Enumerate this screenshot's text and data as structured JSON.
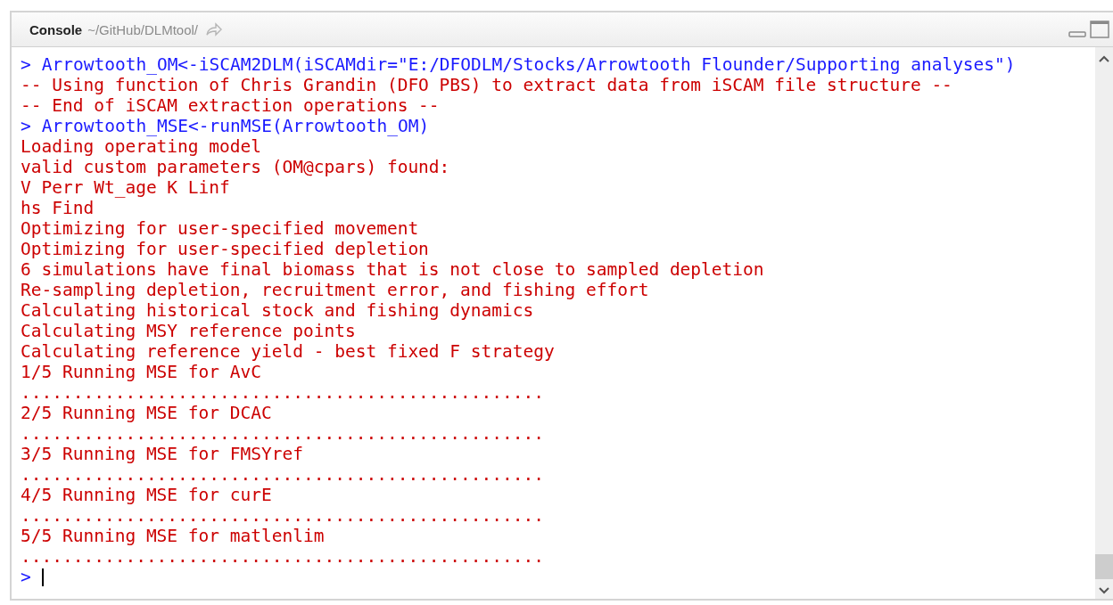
{
  "panel": {
    "title": "Console",
    "path": "~/GitHub/DLMtool/"
  },
  "lines": [
    {
      "kind": "command",
      "prompt": ">",
      "text": "Arrowtooth_OM<-iSCAM2DLM(iSCAMdir=\"E:/DFODLM/Stocks/Arrowtooth Flounder/Supporting analyses\")"
    },
    {
      "kind": "output",
      "text": "-- Using function of Chris Grandin (DFO PBS) to extract data from iSCAM file structure --"
    },
    {
      "kind": "output",
      "text": "-- End of iSCAM extraction operations --"
    },
    {
      "kind": "command",
      "prompt": ">",
      "text": "Arrowtooth_MSE<-runMSE(Arrowtooth_OM)"
    },
    {
      "kind": "output",
      "text": "Loading operating model"
    },
    {
      "kind": "output",
      "text": "valid custom parameters (OM@cpars) found:"
    },
    {
      "kind": "output",
      "text": "V Perr Wt_age K Linf"
    },
    {
      "kind": "output",
      "text": "hs Find"
    },
    {
      "kind": "output",
      "text": "Optimizing for user-specified movement"
    },
    {
      "kind": "output",
      "text": "Optimizing for user-specified depletion"
    },
    {
      "kind": "output",
      "text": "6 simulations have final biomass that is not close to sampled depletion"
    },
    {
      "kind": "output",
      "text": "Re-sampling depletion, recruitment error, and fishing effort"
    },
    {
      "kind": "output",
      "text": "Calculating historical stock and fishing dynamics"
    },
    {
      "kind": "output",
      "text": "Calculating MSY reference points"
    },
    {
      "kind": "output",
      "text": "Calculating reference yield - best fixed F strategy"
    },
    {
      "kind": "output",
      "text": "1/5 Running MSE for AvC"
    },
    {
      "kind": "progress",
      "text": ".................................................."
    },
    {
      "kind": "output",
      "text": "2/5 Running MSE for DCAC"
    },
    {
      "kind": "progress",
      "text": ".................................................."
    },
    {
      "kind": "output",
      "text": "3/5 Running MSE for FMSYref"
    },
    {
      "kind": "progress",
      "text": ".................................................."
    },
    {
      "kind": "output",
      "text": "4/5 Running MSE for curE"
    },
    {
      "kind": "progress",
      "text": ".................................................."
    },
    {
      "kind": "output",
      "text": "5/5 Running MSE for matlenlim"
    },
    {
      "kind": "progress",
      "text": ".................................................."
    }
  ],
  "input": {
    "prompt": ">"
  }
}
